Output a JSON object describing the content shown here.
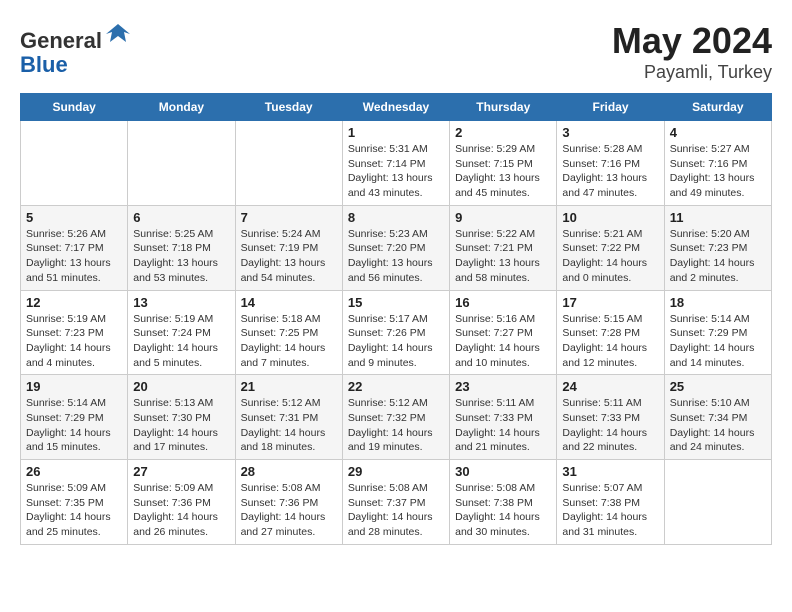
{
  "header": {
    "logo_line1": "General",
    "logo_line2": "Blue",
    "title": "May 2024",
    "location": "Payamli, Turkey"
  },
  "calendar": {
    "days_of_week": [
      "Sunday",
      "Monday",
      "Tuesday",
      "Wednesday",
      "Thursday",
      "Friday",
      "Saturday"
    ],
    "weeks": [
      [
        {
          "day": "",
          "info": ""
        },
        {
          "day": "",
          "info": ""
        },
        {
          "day": "",
          "info": ""
        },
        {
          "day": "1",
          "info": "Sunrise: 5:31 AM\nSunset: 7:14 PM\nDaylight: 13 hours\nand 43 minutes."
        },
        {
          "day": "2",
          "info": "Sunrise: 5:29 AM\nSunset: 7:15 PM\nDaylight: 13 hours\nand 45 minutes."
        },
        {
          "day": "3",
          "info": "Sunrise: 5:28 AM\nSunset: 7:16 PM\nDaylight: 13 hours\nand 47 minutes."
        },
        {
          "day": "4",
          "info": "Sunrise: 5:27 AM\nSunset: 7:16 PM\nDaylight: 13 hours\nand 49 minutes."
        }
      ],
      [
        {
          "day": "5",
          "info": "Sunrise: 5:26 AM\nSunset: 7:17 PM\nDaylight: 13 hours\nand 51 minutes."
        },
        {
          "day": "6",
          "info": "Sunrise: 5:25 AM\nSunset: 7:18 PM\nDaylight: 13 hours\nand 53 minutes."
        },
        {
          "day": "7",
          "info": "Sunrise: 5:24 AM\nSunset: 7:19 PM\nDaylight: 13 hours\nand 54 minutes."
        },
        {
          "day": "8",
          "info": "Sunrise: 5:23 AM\nSunset: 7:20 PM\nDaylight: 13 hours\nand 56 minutes."
        },
        {
          "day": "9",
          "info": "Sunrise: 5:22 AM\nSunset: 7:21 PM\nDaylight: 13 hours\nand 58 minutes."
        },
        {
          "day": "10",
          "info": "Sunrise: 5:21 AM\nSunset: 7:22 PM\nDaylight: 14 hours\nand 0 minutes."
        },
        {
          "day": "11",
          "info": "Sunrise: 5:20 AM\nSunset: 7:23 PM\nDaylight: 14 hours\nand 2 minutes."
        }
      ],
      [
        {
          "day": "12",
          "info": "Sunrise: 5:19 AM\nSunset: 7:23 PM\nDaylight: 14 hours\nand 4 minutes."
        },
        {
          "day": "13",
          "info": "Sunrise: 5:19 AM\nSunset: 7:24 PM\nDaylight: 14 hours\nand 5 minutes."
        },
        {
          "day": "14",
          "info": "Sunrise: 5:18 AM\nSunset: 7:25 PM\nDaylight: 14 hours\nand 7 minutes."
        },
        {
          "day": "15",
          "info": "Sunrise: 5:17 AM\nSunset: 7:26 PM\nDaylight: 14 hours\nand 9 minutes."
        },
        {
          "day": "16",
          "info": "Sunrise: 5:16 AM\nSunset: 7:27 PM\nDaylight: 14 hours\nand 10 minutes."
        },
        {
          "day": "17",
          "info": "Sunrise: 5:15 AM\nSunset: 7:28 PM\nDaylight: 14 hours\nand 12 minutes."
        },
        {
          "day": "18",
          "info": "Sunrise: 5:14 AM\nSunset: 7:29 PM\nDaylight: 14 hours\nand 14 minutes."
        }
      ],
      [
        {
          "day": "19",
          "info": "Sunrise: 5:14 AM\nSunset: 7:29 PM\nDaylight: 14 hours\nand 15 minutes."
        },
        {
          "day": "20",
          "info": "Sunrise: 5:13 AM\nSunset: 7:30 PM\nDaylight: 14 hours\nand 17 minutes."
        },
        {
          "day": "21",
          "info": "Sunrise: 5:12 AM\nSunset: 7:31 PM\nDaylight: 14 hours\nand 18 minutes."
        },
        {
          "day": "22",
          "info": "Sunrise: 5:12 AM\nSunset: 7:32 PM\nDaylight: 14 hours\nand 19 minutes."
        },
        {
          "day": "23",
          "info": "Sunrise: 5:11 AM\nSunset: 7:33 PM\nDaylight: 14 hours\nand 21 minutes."
        },
        {
          "day": "24",
          "info": "Sunrise: 5:11 AM\nSunset: 7:33 PM\nDaylight: 14 hours\nand 22 minutes."
        },
        {
          "day": "25",
          "info": "Sunrise: 5:10 AM\nSunset: 7:34 PM\nDaylight: 14 hours\nand 24 minutes."
        }
      ],
      [
        {
          "day": "26",
          "info": "Sunrise: 5:09 AM\nSunset: 7:35 PM\nDaylight: 14 hours\nand 25 minutes."
        },
        {
          "day": "27",
          "info": "Sunrise: 5:09 AM\nSunset: 7:36 PM\nDaylight: 14 hours\nand 26 minutes."
        },
        {
          "day": "28",
          "info": "Sunrise: 5:08 AM\nSunset: 7:36 PM\nDaylight: 14 hours\nand 27 minutes."
        },
        {
          "day": "29",
          "info": "Sunrise: 5:08 AM\nSunset: 7:37 PM\nDaylight: 14 hours\nand 28 minutes."
        },
        {
          "day": "30",
          "info": "Sunrise: 5:08 AM\nSunset: 7:38 PM\nDaylight: 14 hours\nand 30 minutes."
        },
        {
          "day": "31",
          "info": "Sunrise: 5:07 AM\nSunset: 7:38 PM\nDaylight: 14 hours\nand 31 minutes."
        },
        {
          "day": "",
          "info": ""
        }
      ]
    ]
  }
}
